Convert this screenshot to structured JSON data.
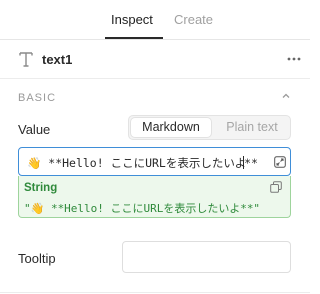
{
  "tabs": [
    {
      "label": "Inspect",
      "active": true
    },
    {
      "label": "Create",
      "active": false
    }
  ],
  "component": {
    "icon": "text-type-icon",
    "name": "text1",
    "menu_icon": "more-horizontal-icon"
  },
  "section": {
    "title": "BASIC",
    "state_icon": "chevron-up-icon"
  },
  "value_field": {
    "label": "Value",
    "modes": [
      "Markdown",
      "Plain text"
    ],
    "selected_mode": "Markdown",
    "emoji": "👋",
    "before_cursor": "**Hello! ここにURLを表示したいよ",
    "after_cursor": "**",
    "expand_icon": "expand-icon"
  },
  "preview": {
    "type": "String",
    "value": "\"👋 **Hello! ここにURLを表示したいよ**\"",
    "copy_icon": "copy-icon"
  },
  "tooltip": {
    "label": "Tooltip",
    "value": ""
  },
  "colors": {
    "accent": "#3f8ed8",
    "success_text": "#2f8a3b",
    "success_bg": "#edf8ec",
    "success_border": "#9ed49c"
  }
}
